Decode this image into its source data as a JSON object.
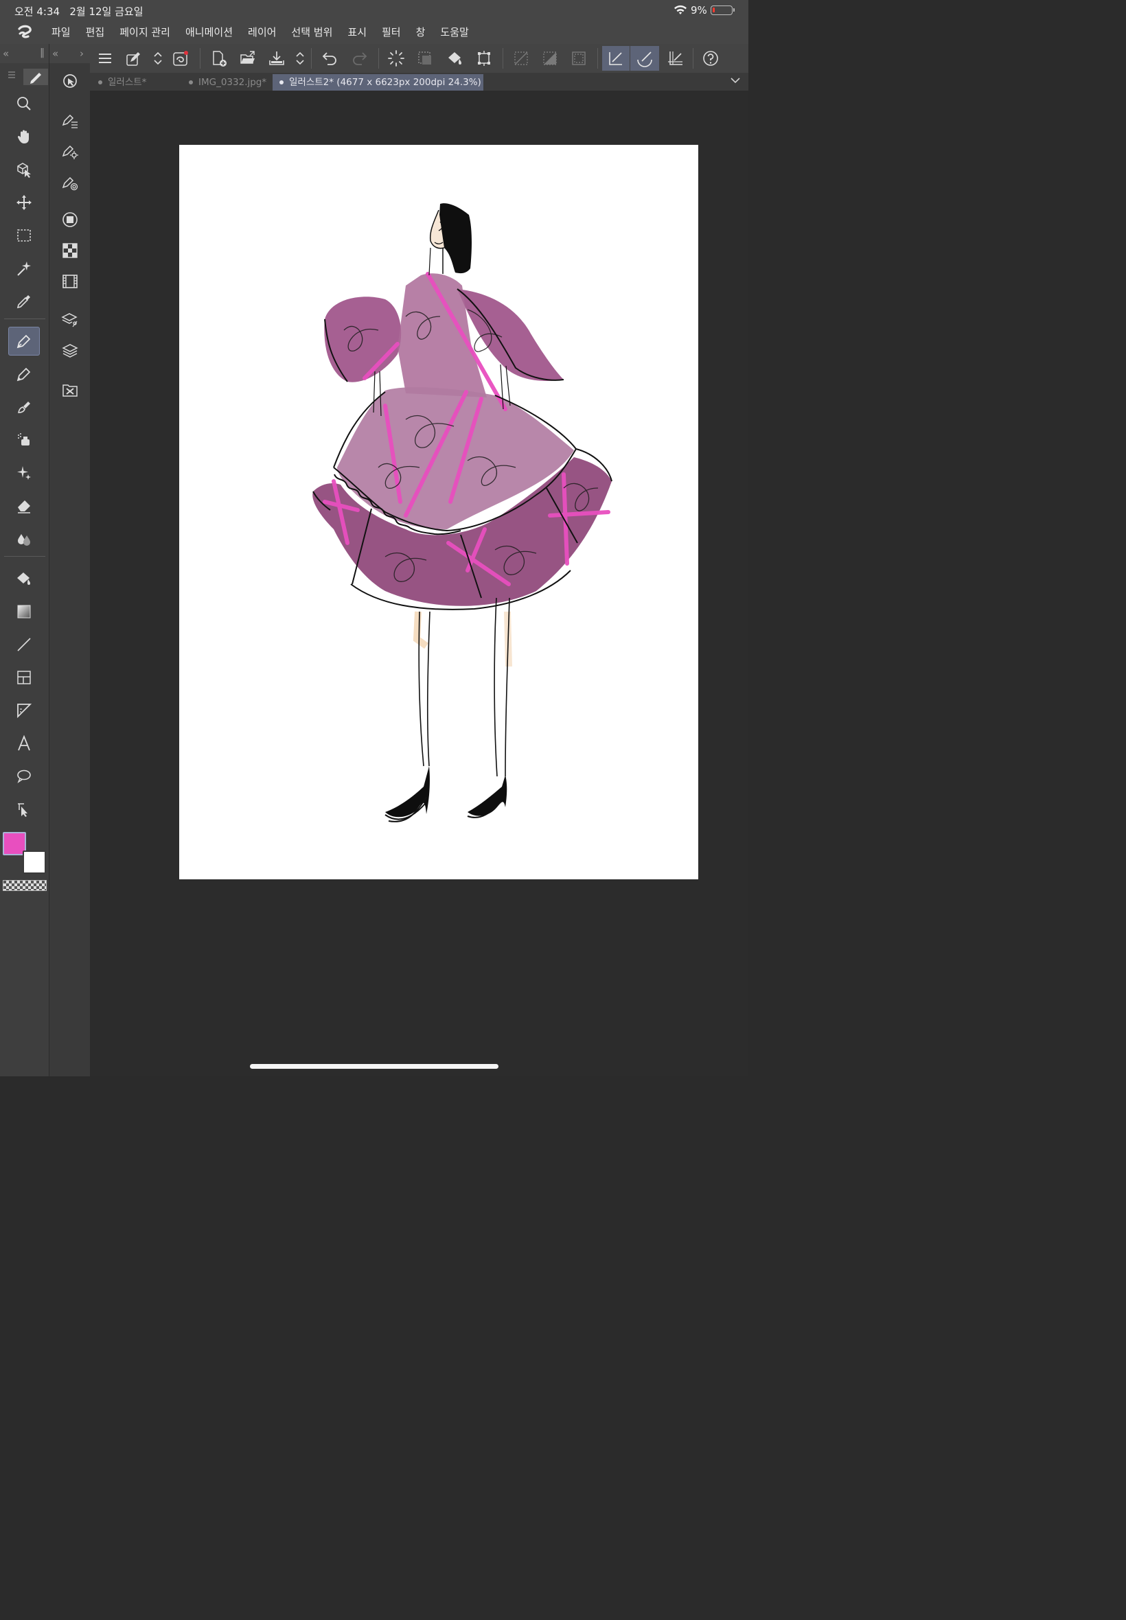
{
  "status_bar": {
    "time": "오전 4:34   2월 12일 금요일",
    "battery": "9%"
  },
  "menu": {
    "items": [
      "파일",
      "편집",
      "페이지 관리",
      "애니메이션",
      "레이어",
      "선택 범위",
      "표시",
      "필터",
      "창",
      "도움말"
    ]
  },
  "tabs": [
    {
      "label": "일러스트*",
      "active": false
    },
    {
      "label": "IMG_0332.jpg*",
      "active": false
    },
    {
      "label": "일러스트2* (4677 x 6623px 200dpi 24.3%)",
      "active": true
    }
  ],
  "tools": {
    "active": "pen",
    "items": [
      "zoom",
      "hand",
      "object-select",
      "move",
      "marquee",
      "auto-select",
      "eyedropper",
      "pen",
      "pencil",
      "brush",
      "airbrush",
      "decoration",
      "eraser",
      "blend",
      "fill",
      "gradient",
      "figure",
      "frame-border",
      "ruler",
      "text",
      "balloon",
      "correct-line"
    ]
  },
  "sub_tools": [
    "sub-tool-panel",
    "tool-property",
    "brush-size",
    "brush-shape",
    "color-circle",
    "color-set",
    "animation-timeline",
    "layer-property",
    "layer",
    "material"
  ],
  "commands": [
    "menu",
    "settings",
    "expand",
    "companion-mode",
    "new",
    "open",
    "save",
    "more",
    "undo",
    "redo",
    "clear-selection",
    "deselect",
    "fill",
    "transform",
    "hide-selection",
    "invert-selection",
    "selection-edge",
    "snap-ruler",
    "snap-special-ruler",
    "snap-grid",
    "help"
  ],
  "colors": {
    "main": "#e84fbf",
    "sub": "#ffffff",
    "accent": "#5d6478"
  }
}
